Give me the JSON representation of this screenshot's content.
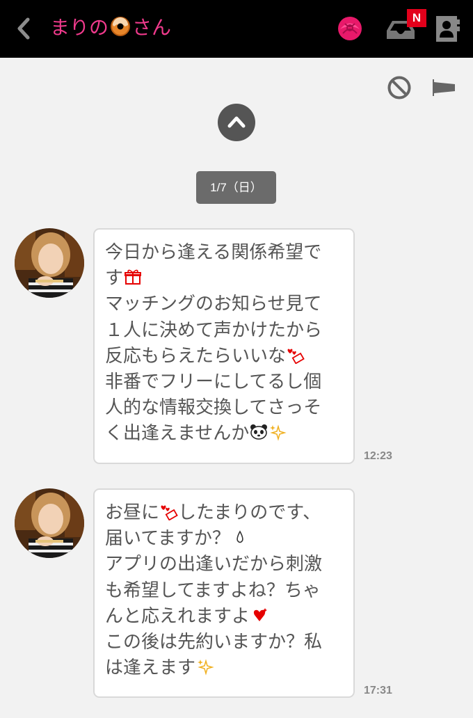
{
  "header": {
    "title_prefix": "まりの",
    "title_suffix": "さん",
    "badge": "N"
  },
  "thread": {
    "date_label": "1/7（日）"
  },
  "messages": [
    {
      "time": "12:23",
      "lines": [
        "今日から逢える関係希望で",
        "す",
        "マッチングのお知らせ見て",
        "１人に決めて声かけたから",
        "反応もらえたらいいな",
        "非番でフリーにしてるし個",
        "人的な情報交換してさっそ",
        "く出逢えませんか"
      ]
    },
    {
      "time": "17:31",
      "lines": [
        "お昼に",
        "したまりのです、",
        "届いてますか？",
        "アプリの出逢いだから刺激",
        "も希望してますよね？ちゃ",
        "んと応えれますよ",
        "この後は先約いますか？私",
        "は逢えます"
      ]
    }
  ],
  "icons": {
    "back": "chevron-left-icon",
    "rose": "rose-icon",
    "inbox": "inbox-tray-icon",
    "profile": "profile-card-icon",
    "block": "block-icon",
    "report": "flag-icon",
    "load_more": "chevron-up-icon"
  },
  "colors": {
    "accent": "#f03a8c",
    "badge": "#e3001b",
    "header_bg": "#000000",
    "background": "#f2f2f2"
  }
}
